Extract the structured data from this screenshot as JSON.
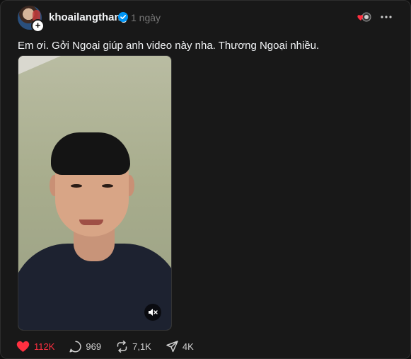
{
  "post": {
    "username": "khoailangthang",
    "time": "1 ngày",
    "text": "Em ơi. Gởi Ngoại giúp anh video này nha. Thương Ngoại nhiều.",
    "follow_symbol": "+"
  },
  "actions": {
    "likes": "112K",
    "comments": "969",
    "reposts": "7,1K",
    "shares": "4K"
  },
  "icons": [
    "follow-plus-icon",
    "verified-badge-icon",
    "reaction-heart-icon",
    "more-dots-icon",
    "mute-icon",
    "heart-icon",
    "comment-icon",
    "repost-icon",
    "share-icon"
  ],
  "colors": {
    "background": "#181818",
    "text": "#f3f5f7",
    "muted": "#777777",
    "like": "#ff3040",
    "verified": "#0095f6"
  }
}
